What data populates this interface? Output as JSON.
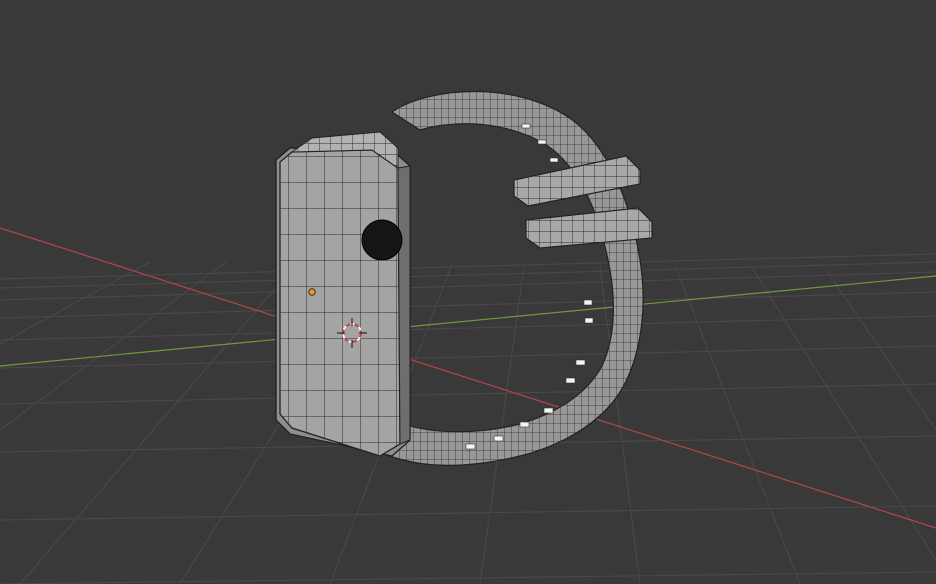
{
  "viewport": {
    "mode": "3d-viewport",
    "view": "perspective",
    "shading": "solid-wireframe",
    "colors": {
      "background": "#393939",
      "grid_line": "#4a4a4a",
      "x_axis": "#b04848",
      "y_axis": "#6f9a3c",
      "mesh_fill": "#9a9a9a",
      "mesh_fill_light": "#b5b5b5",
      "mesh_fill_dark": "#6e6e6e",
      "wire": "#2a2a2a",
      "origin_dot": "#f29d2a",
      "cursor_red": "#d63a3a",
      "cursor_white": "#f0f0f0"
    }
  },
  "scene": {
    "objects": [
      {
        "name": "watch-body",
        "selected": false
      },
      {
        "name": "watch-crown",
        "selected": false
      },
      {
        "name": "watch-strap",
        "selected": false
      },
      {
        "name": "strap-loop-upper",
        "selected": false
      },
      {
        "name": "strap-loop-lower",
        "selected": false
      }
    ],
    "icons": {
      "origin": "object-origin-icon",
      "cursor": "3d-cursor-icon"
    }
  }
}
